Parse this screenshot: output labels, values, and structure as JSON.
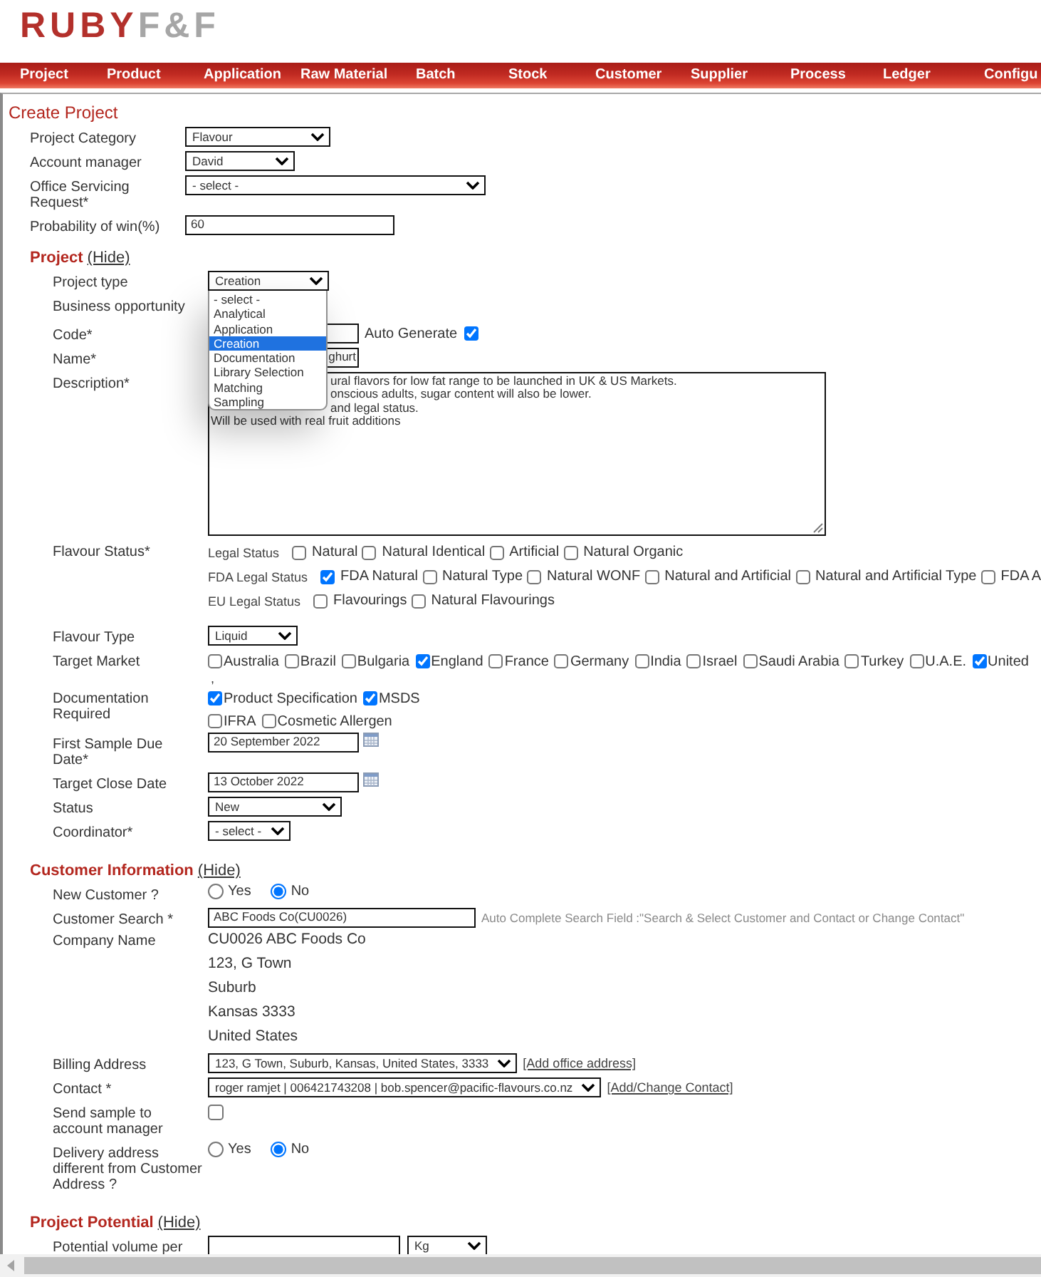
{
  "logo": {
    "brand": "RUBY",
    "suffix": "F&F"
  },
  "nav": [
    "Project",
    "Product",
    "Application",
    "Raw Material",
    "Batch",
    "Stock",
    "Customer",
    "Supplier",
    "Process",
    "Ledger",
    "Configu"
  ],
  "title": "Create Project",
  "general": [
    {
      "kind": "select",
      "label": "Project Category",
      "value": "Flavour"
    },
    {
      "kind": "select",
      "label": "Account manager",
      "value": "David"
    },
    {
      "kind": "select",
      "label": "Office Servicing Request*",
      "value": "- select -"
    },
    {
      "kind": "input",
      "label": "Probability of win(%)",
      "value": "60"
    }
  ],
  "project": {
    "heading": "Project",
    "toggle": "(Hide)",
    "fields": [
      {
        "kind": "open_select",
        "label": "Project type",
        "value": "Creation",
        "options": [
          {
            "label": "- select -",
            "selected": false
          },
          {
            "label": "Analytical",
            "selected": false
          },
          {
            "label": "Application",
            "selected": false
          },
          {
            "label": "Creation",
            "selected": true
          },
          {
            "label": "Documentation",
            "selected": false
          },
          {
            "label": "Library Selection",
            "selected": false
          },
          {
            "label": "Matching",
            "selected": false
          },
          {
            "label": "Sampling",
            "selected": false
          }
        ]
      },
      {
        "kind": "blank",
        "label": "Business opportunity"
      },
      {
        "kind": "code",
        "label": "Code*",
        "covered": true,
        "auto_generate": {
          "label": "Auto Generate",
          "checked": true
        }
      },
      {
        "kind": "input",
        "label": "Name*",
        "value": "ghurt",
        "covered": true
      },
      {
        "kind": "textarea",
        "label": "Description*",
        "lines": [
          {
            "text": "ural flavors for low fat range to be launched in UK & US Markets.",
            "covered": true
          },
          {
            "text": "onscious adults, sugar content will also be lower.",
            "covered": true
          },
          {
            "text": "and legal status.",
            "covered": true
          },
          {
            "text": "Will be used with real fruit additions",
            "covered": false
          }
        ]
      },
      {
        "kind": "check_groups",
        "label": "Flavour Status*",
        "groups": [
          {
            "title": "Legal Status",
            "options": [
              {
                "label": "Natural",
                "checked": false
              },
              {
                "label": "Natural Identical",
                "checked": false
              },
              {
                "label": "Artificial",
                "checked": false
              },
              {
                "label": "Natural Organic",
                "checked": false
              }
            ]
          },
          {
            "title": "FDA Legal Status",
            "options": [
              {
                "label": "FDA Natural",
                "checked": true
              },
              {
                "label": "Natural Type",
                "checked": false
              },
              {
                "label": "Natural WONF",
                "checked": false
              },
              {
                "label": "Natural and Artificial",
                "checked": false
              },
              {
                "label": "Natural and Artificial Type",
                "checked": false
              },
              {
                "label": "FDA A",
                "checked": false
              }
            ]
          },
          {
            "title": "EU Legal Status",
            "options": [
              {
                "label": "Flavourings",
                "checked": false
              },
              {
                "label": "Natural Flavourings",
                "checked": false
              }
            ]
          }
        ]
      },
      {
        "kind": "select",
        "label": "Flavour Type",
        "value": "Liquid"
      },
      {
        "kind": "check_lines",
        "label": "Target Market",
        "lines": [
          [
            {
              "label": "Australia",
              "checked": false
            },
            {
              "label": "Brazil",
              "checked": false
            },
            {
              "label": "Bulgaria",
              "checked": false
            },
            {
              "label": "England",
              "checked": true
            },
            {
              "label": "France",
              "checked": false
            },
            {
              "label": "Germany",
              "checked": false
            },
            {
              "label": "India",
              "checked": false
            },
            {
              "label": "Israel",
              "checked": false
            },
            {
              "label": "Saudi Arabia",
              "checked": false
            },
            {
              "label": "Turkey",
              "checked": false
            },
            {
              "label": "U.A.E.",
              "checked": false
            },
            {
              "label": "United",
              "checked": true
            }
          ]
        ],
        "note": ","
      },
      {
        "kind": "check_lines",
        "label": "Documentation Required",
        "lines": [
          [
            {
              "label": "Product Specification",
              "checked": true
            },
            {
              "label": "MSDS",
              "checked": true
            }
          ],
          [
            {
              "label": "IFRA",
              "checked": false
            },
            {
              "label": "Cosmetic Allergen",
              "checked": false
            }
          ]
        ]
      },
      {
        "kind": "date",
        "label": "First Sample Due Date*",
        "value": "20 September 2022"
      },
      {
        "kind": "date",
        "label": "Target Close Date",
        "value": "13 October 2022"
      },
      {
        "kind": "select",
        "label": "Status",
        "value": "New"
      },
      {
        "kind": "select",
        "label": "Coordinator*",
        "value": "- select -"
      }
    ]
  },
  "customer": {
    "heading": "Customer Information",
    "toggle": "(Hide)",
    "fields": [
      {
        "kind": "radio",
        "label": "New Customer ?",
        "options": [
          {
            "label": "Yes",
            "selected": false
          },
          {
            "label": "No",
            "selected": true
          }
        ]
      },
      {
        "kind": "search",
        "label": "Customer Search *",
        "value": "ABC Foods Co(CU0026)",
        "hint": "Auto Complete Search Field :\"Search & Select Customer and Contact or Change Contact\""
      },
      {
        "kind": "text_lines",
        "label": "Company Name",
        "lines": [
          "CU0026 ABC Foods Co",
          "123, G Town",
          "Suburb",
          "Kansas 3333",
          "United States"
        ]
      },
      {
        "kind": "select_link",
        "label": "Billing Address",
        "value": "123, G Town, Suburb, Kansas, United States, 3333",
        "link": "[Add office address]"
      },
      {
        "kind": "select_link",
        "label": "Contact *",
        "value": "roger ramjet | 006421743208 | bob.spencer@pacific-flavours.co.nz",
        "link": "[Add/Change Contact]"
      },
      {
        "kind": "checkbox",
        "label": "Send sample to account manager",
        "checked": false
      },
      {
        "kind": "radio",
        "label": "Delivery address different from Customer Address ?",
        "options": [
          {
            "label": "Yes",
            "selected": false
          },
          {
            "label": "No",
            "selected": true
          }
        ]
      }
    ]
  },
  "potential": {
    "heading": "Project Potential",
    "toggle": "(Hide)",
    "fields": [
      {
        "kind": "input_unit",
        "label": "Potential volume per",
        "unit": "Kg"
      }
    ]
  }
}
